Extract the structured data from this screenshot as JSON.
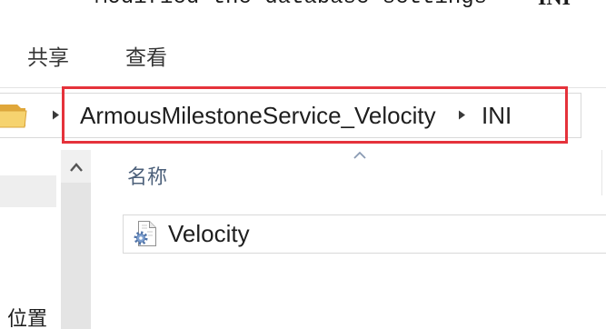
{
  "document_caption": {
    "text": "Modified the database settings",
    "side_text": "INI"
  },
  "ribbon": {
    "tabs": [
      "共享",
      "查看"
    ]
  },
  "address_bar": {
    "location_icon": "folder-icon",
    "separator_icon": "chevron-right-icon",
    "breadcrumb": [
      "ArmousMilestoneService_Velocity",
      "INI"
    ]
  },
  "navigation_pane": {
    "scroll_up_icon": "chevron-up-icon",
    "item_label": "位置"
  },
  "file_list": {
    "sort_icon": "sort-ascending-icon",
    "columns": [
      "名称"
    ],
    "items": [
      {
        "name": "Velocity",
        "icon": "ini-settings-file-icon"
      }
    ]
  },
  "colors": {
    "highlight_border": "#e5323b",
    "column_header_text": "#4c607a",
    "folder": "#f6d36f"
  }
}
